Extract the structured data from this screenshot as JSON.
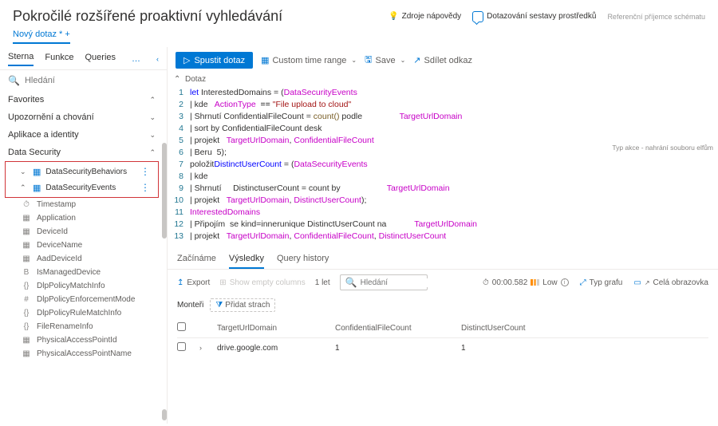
{
  "header": {
    "title": "Pokročilé rozšířené proaktivní vyhledávání",
    "help": "Zdroje nápovědy",
    "resources": "Dotazování sestavy prostředků",
    "schema": "Referenční příjemce schématu"
  },
  "newQuery": "Nový dotaz",
  "sidebar": {
    "tabs": [
      "Sterna",
      "Funkce",
      "Queries"
    ],
    "searchPlaceholder": "Hledání",
    "favorites": "Favorites",
    "sections": [
      {
        "label": "Upozornění a chování"
      },
      {
        "label": "Aplikace a identity"
      }
    ],
    "dataSecurity": "Data Security",
    "tables": [
      {
        "label": "DataSecurityBehaviors"
      },
      {
        "label": "DataSecurityEvents"
      }
    ],
    "fields": [
      {
        "icon": "⏱",
        "label": "Timestamp"
      },
      {
        "icon": "▦",
        "label": "Application"
      },
      {
        "icon": "▦",
        "label": "DeviceId"
      },
      {
        "icon": "▦",
        "label": "DeviceName"
      },
      {
        "icon": "▦",
        "label": "AadDeviceId"
      },
      {
        "icon": "B",
        "label": "IsManagedDevice"
      },
      {
        "icon": "{}",
        "label": "DlpPolicyMatchInfo"
      },
      {
        "icon": "#",
        "label": "DlpPolicyEnforcementMode"
      },
      {
        "icon": "{}",
        "label": "DlpPolicyRuleMatchInfo"
      },
      {
        "icon": "{}",
        "label": "FileRenameInfo"
      },
      {
        "icon": "▦",
        "label": "PhysicalAccessPointId"
      },
      {
        "icon": "▦",
        "label": "PhysicalAccessPointName"
      }
    ]
  },
  "toolbar": {
    "run": "Spustit dotaz",
    "timeRange": "Custom time range",
    "save": "Save",
    "share": "Sdílet odkaz"
  },
  "query": {
    "collapseLabel": "Dotaz",
    "lines": [
      {
        "n": 1,
        "t": [
          [
            "kw",
            "let"
          ],
          [
            "",
            " InterestedDomains = ("
          ],
          [
            "tbl",
            "DataSecurityEvents"
          ]
        ]
      },
      {
        "n": 2,
        "t": [
          [
            "pipe",
            "| kde   "
          ],
          [
            "col",
            "ActionType"
          ],
          [
            "op",
            "  == "
          ],
          [
            "str",
            "\"File upload to cloud\""
          ]
        ]
      },
      {
        "n": 3,
        "t": [
          [
            "pipe",
            "| Shrnutí "
          ],
          [
            "",
            "ConfidentialFileCount = "
          ],
          [
            "fn",
            "count()"
          ],
          [
            "",
            " podle                "
          ],
          [
            "col",
            "TargetUrlDomain"
          ]
        ]
      },
      {
        "n": 4,
        "t": [
          [
            "pipe",
            "| sort by ConfidentialFileCount desk"
          ]
        ]
      },
      {
        "n": 5,
        "t": [
          [
            "pipe",
            "| projekt   "
          ],
          [
            "col",
            "TargetUrlDomain"
          ],
          [
            "",
            ", "
          ],
          [
            "col",
            "ConfidentialFileCount"
          ]
        ]
      },
      {
        "n": 6,
        "t": [
          [
            "pipe",
            "| Beru  5);"
          ]
        ]
      },
      {
        "n": 7,
        "t": [
          [
            "",
            "položit"
          ],
          [
            "kw",
            "DistinctUserCount"
          ],
          [
            "",
            " = ("
          ],
          [
            "tbl",
            "DataSecurityEvents"
          ]
        ]
      },
      {
        "n": 8,
        "t": [
          [
            "pipe",
            "| kde"
          ]
        ]
      },
      {
        "n": 9,
        "t": [
          [
            "pipe",
            "| Shrnutí     "
          ],
          [
            "",
            "DistinctuserCount = count by                    "
          ],
          [
            "col",
            "TargetUrlDomain"
          ]
        ]
      },
      {
        "n": 10,
        "t": [
          [
            "pipe",
            "| projekt   "
          ],
          [
            "col",
            "TargetUrlDomain"
          ],
          [
            "",
            ", "
          ],
          [
            "col",
            "DistinctUserCount"
          ],
          [
            "",
            ");"
          ]
        ]
      },
      {
        "n": 11,
        "t": [
          [
            "tbl",
            "InterestedDomains"
          ]
        ]
      },
      {
        "n": 12,
        "t": [
          [
            "pipe",
            "| Připojím  se kind=innerunique DistinctUserCount na            "
          ],
          [
            "col",
            "TargetUrlDomain"
          ]
        ]
      },
      {
        "n": 13,
        "t": [
          [
            "pipe",
            "| projekt   "
          ],
          [
            "col",
            "TargetUrlDomain"
          ],
          [
            "",
            ", "
          ],
          [
            "col",
            "ConfidentialFileCount"
          ],
          [
            "",
            ", "
          ],
          [
            "col",
            "DistinctUserCount"
          ]
        ]
      }
    ],
    "sideHint": "Typ akce - nahrání souboru elfům"
  },
  "results": {
    "tabs": [
      "Začínáme",
      "Výsledky",
      "Query history"
    ],
    "export": "Export",
    "showEmpty": "Show empty columns",
    "count": "1 let",
    "searchPlaceholder": "Hledání",
    "elapsed": "00:00.582",
    "level": "Low",
    "chartType": "Typ grafu",
    "fullscreen": "Celá obrazovka",
    "filtersLabel": "Monteři",
    "addFilter": "Přidat strach",
    "columns": [
      "TargetUrlDomain",
      "ConfidentialFileCount",
      "DistinctUserCount"
    ],
    "rows": [
      {
        "domain": "drive.google.com",
        "cfc": "1",
        "duc": "1"
      }
    ]
  }
}
